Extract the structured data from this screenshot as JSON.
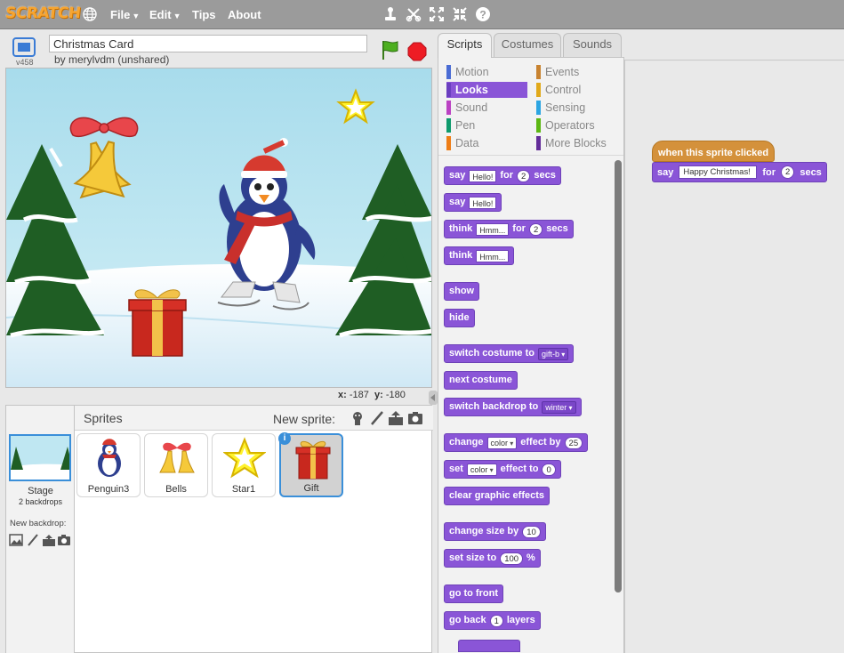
{
  "menubar": {
    "logo": "SCRATCH",
    "menus": [
      "File",
      "Edit",
      "Tips",
      "About"
    ]
  },
  "project": {
    "version": "v458",
    "title": "Christmas Card",
    "byline": "by merylvdm (unshared)"
  },
  "stage": {
    "x_label": "x:",
    "x_value": "-187",
    "y_label": "y:",
    "y_value": "-180"
  },
  "sprites_panel": {
    "title": "Sprites",
    "new_sprite_label": "New sprite:",
    "stage_label": "Stage",
    "stage_sub": "2 backdrops",
    "new_backdrop_label": "New backdrop:",
    "sprites": [
      {
        "name": "Penguin3",
        "selected": false
      },
      {
        "name": "Bells",
        "selected": false
      },
      {
        "name": "Star1",
        "selected": false
      },
      {
        "name": "Gift",
        "selected": true
      }
    ],
    "info_badge": "i"
  },
  "tabs": [
    "Scripts",
    "Costumes",
    "Sounds"
  ],
  "categories": [
    {
      "name": "Motion",
      "color": "#4a6cd4"
    },
    {
      "name": "Events",
      "color": "#c88330"
    },
    {
      "name": "Looks",
      "color": "#8a55d7"
    },
    {
      "name": "Control",
      "color": "#e1a91a"
    },
    {
      "name": "Sound",
      "color": "#bb42c3"
    },
    {
      "name": "Sensing",
      "color": "#2ca5e2"
    },
    {
      "name": "Pen",
      "color": "#0e9a6c"
    },
    {
      "name": "Operators",
      "color": "#5cb712"
    },
    {
      "name": "Data",
      "color": "#ee7d16"
    },
    {
      "name": "More Blocks",
      "color": "#632d99"
    }
  ],
  "palette_blocks": {
    "say_for": {
      "say": "say",
      "text": "Hello!",
      "for": "for",
      "num": "2",
      "secs": "secs"
    },
    "say": {
      "say": "say",
      "text": "Hello!"
    },
    "think_for": {
      "think": "think",
      "text": "Hmm...",
      "for": "for",
      "num": "2",
      "secs": "secs"
    },
    "think": {
      "think": "think",
      "text": "Hmm..."
    },
    "show": "show",
    "hide": "hide",
    "switch_costume": {
      "label": "switch costume to",
      "value": "gift-b"
    },
    "next_costume": "next costume",
    "switch_backdrop": {
      "label": "switch backdrop to",
      "value": "winter"
    },
    "change_effect": {
      "change": "change",
      "effect": "color",
      "effect_by": "effect by",
      "num": "25"
    },
    "set_effect": {
      "set": "set",
      "effect": "color",
      "effect_to": "effect to",
      "num": "0"
    },
    "clear_effects": "clear graphic effects",
    "change_size": {
      "label": "change size by",
      "num": "10"
    },
    "set_size": {
      "label": "set size to",
      "num": "100",
      "unit": "%"
    },
    "go_front": "go to front",
    "go_back": {
      "go_back": "go back",
      "num": "1",
      "layers": "layers"
    }
  },
  "script": {
    "hat": "when this sprite clicked",
    "say": "say",
    "say_text": "Happy Christmas!",
    "for": "for",
    "num": "2",
    "secs": "secs"
  }
}
